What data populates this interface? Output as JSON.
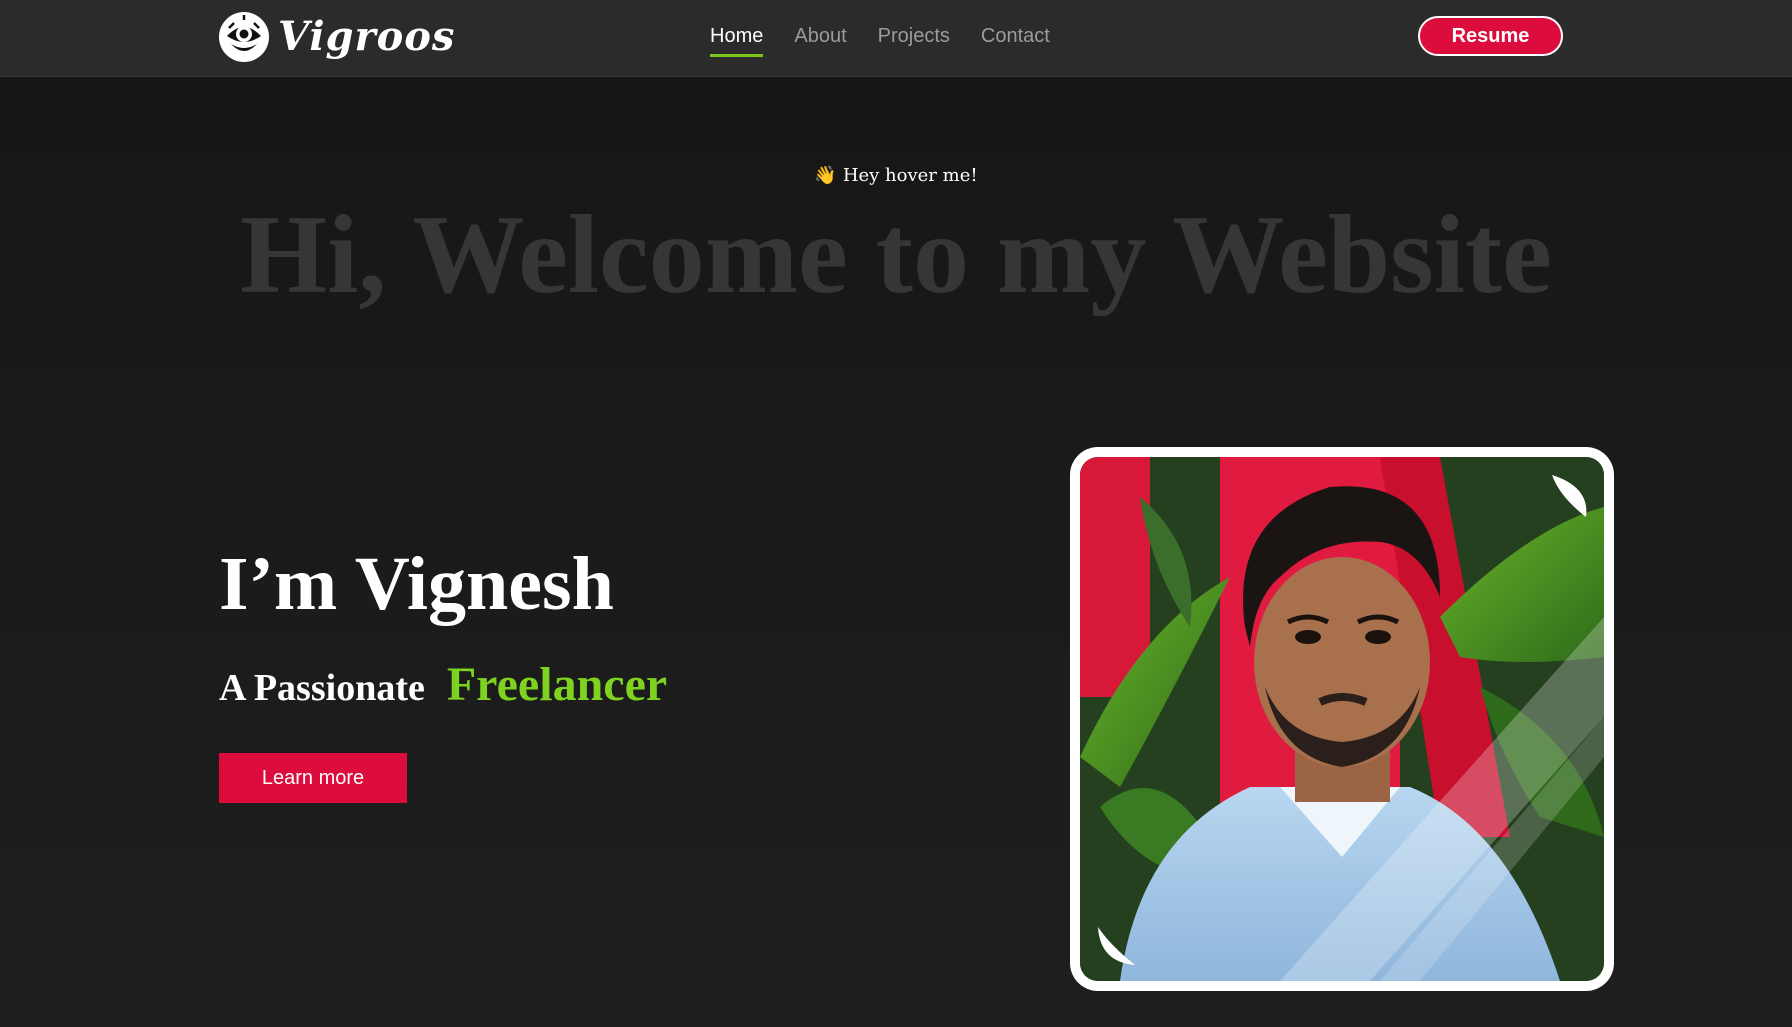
{
  "navbar": {
    "brand_name": "Vigroos",
    "logo_icon": "eye-mascot-icon",
    "links": [
      {
        "label": "Home",
        "active": true
      },
      {
        "label": "About",
        "active": false
      },
      {
        "label": "Projects",
        "active": false
      },
      {
        "label": "Contact",
        "active": false
      }
    ],
    "resume_label": "Resume"
  },
  "hero": {
    "hover_hint": "Hey hover me!",
    "hover_icon": "waving-hand-icon",
    "welcome_text": "Hi, Welcome to my Website",
    "greeting": "I’m Vignesh",
    "tagline_prefix": "A Passionate",
    "tagline_role": "Freelancer",
    "learn_more_label": "Learn more"
  },
  "profile_photo": {
    "description_icon": "profile-photo"
  },
  "colors": {
    "accent_red": "#dc0c3c",
    "accent_green": "#7ed321",
    "nav_bg": "#2b2b2b",
    "page_bg": "#1c1c1c",
    "welcome_text": "#363636"
  }
}
